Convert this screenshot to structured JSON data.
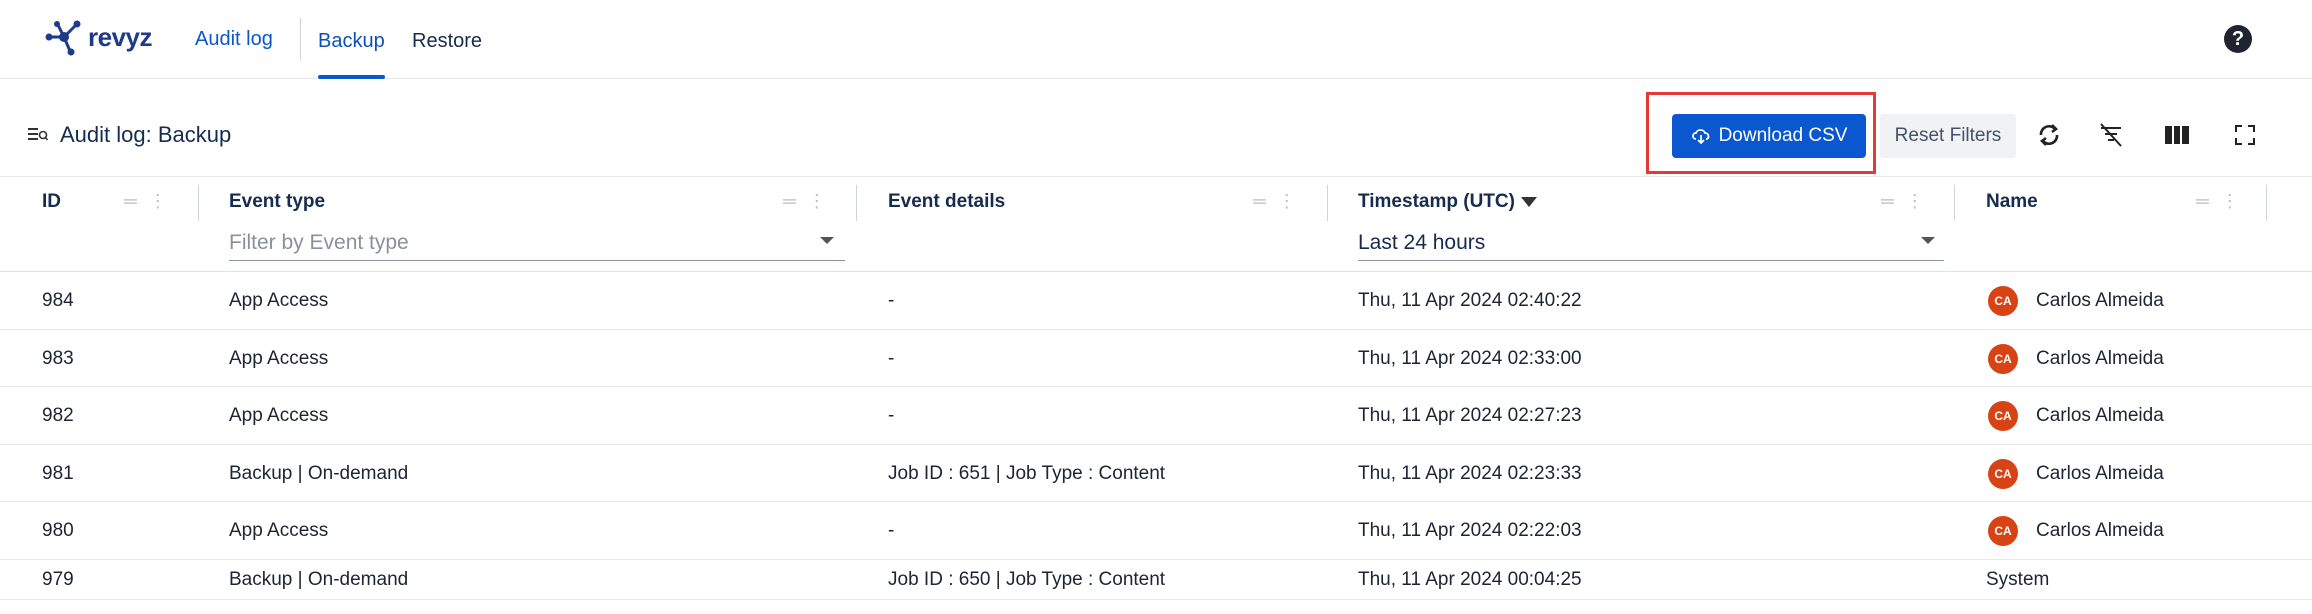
{
  "nav": {
    "logo_text": "revyz",
    "audit_log": "Audit log",
    "backup": "Backup",
    "restore": "Restore",
    "help": "?"
  },
  "toolbar": {
    "title": "Audit log: Backup",
    "download_csv": "Download CSV",
    "reset_filters": "Reset Filters"
  },
  "columns": [
    {
      "label": "ID"
    },
    {
      "label": "Event type",
      "filter_placeholder": "Filter by Event type"
    },
    {
      "label": "Event details"
    },
    {
      "label": "Timestamp (UTC)",
      "filter_value": "Last 24 hours"
    },
    {
      "label": "Name"
    }
  ],
  "rows": [
    {
      "id": "984",
      "event_type": "App Access",
      "details": "-",
      "timestamp": "Thu, 11 Apr 2024 02:40:22",
      "avatar": "CA",
      "name": "Carlos Almeida"
    },
    {
      "id": "983",
      "event_type": "App Access",
      "details": "-",
      "timestamp": "Thu, 11 Apr 2024 02:33:00",
      "avatar": "CA",
      "name": "Carlos Almeida"
    },
    {
      "id": "982",
      "event_type": "App Access",
      "details": "-",
      "timestamp": "Thu, 11 Apr 2024 02:27:23",
      "avatar": "CA",
      "name": "Carlos Almeida"
    },
    {
      "id": "981",
      "event_type": "Backup | On-demand",
      "details": "Job ID : 651 | Job Type : Content",
      "timestamp": "Thu, 11 Apr 2024 02:23:33",
      "avatar": "CA",
      "name": "Carlos Almeida"
    },
    {
      "id": "980",
      "event_type": "App Access",
      "details": "-",
      "timestamp": "Thu, 11 Apr 2024 02:22:03",
      "avatar": "CA",
      "name": "Carlos Almeida"
    },
    {
      "id": "979",
      "event_type": "Backup | On-demand",
      "details": "Job ID : 650 | Job Type : Content",
      "timestamp": "Thu, 11 Apr 2024 00:04:25",
      "avatar": "",
      "name": "System"
    }
  ],
  "colors": {
    "primary": "#0b57d0",
    "avatar": "#d84315",
    "highlight": "#e53935"
  }
}
